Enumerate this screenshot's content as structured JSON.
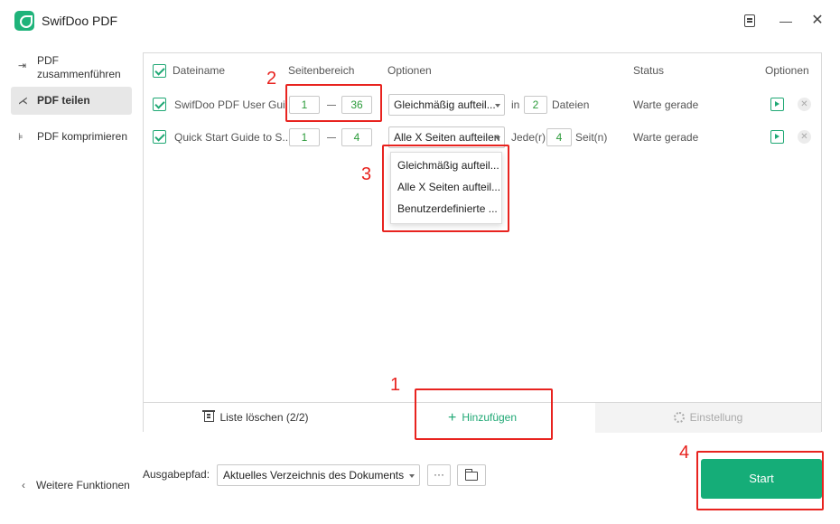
{
  "app": {
    "title": "SwifDoo PDF",
    "brand_color": "#1fb37a"
  },
  "window_controls": {
    "minimize": "—",
    "close": "✕"
  },
  "sidebar": {
    "items": [
      {
        "label": "PDF zusammenführen",
        "icon": "merge-icon"
      },
      {
        "label": "PDF teilen",
        "icon": "split-icon",
        "active": true
      },
      {
        "label": "PDF komprimieren",
        "icon": "compress-icon"
      }
    ],
    "more_label": "Weitere Funktionen"
  },
  "table": {
    "headers": {
      "name": "Dateiname",
      "range": "Seitenbereich",
      "options": "Optionen",
      "status": "Status",
      "actions": "Optionen"
    },
    "rows": [
      {
        "name": "SwifDoo PDF User Gui...",
        "from": "1",
        "to": "36",
        "mode": "Gleichmäßig aufteil...",
        "pre": "in",
        "count": "2",
        "post": "Dateien",
        "status": "Warte gerade"
      },
      {
        "name": "Quick Start Guide to S...",
        "from": "1",
        "to": "4",
        "mode": "Alle X Seiten aufteilen",
        "pre": "Jede(r)",
        "count": "4",
        "post": "Seit(n)",
        "status": "Warte gerade"
      }
    ],
    "dropdown_options": [
      "Gleichmäßig aufteil...",
      "Alle X Seiten aufteil...",
      "Benutzerdefinierte ..."
    ]
  },
  "panel_footer": {
    "clear_label": "Liste löschen (2/2)",
    "add_label": "Hinzufügen",
    "settings_label": "Einstellung"
  },
  "output": {
    "label": "Ausgabepfad:",
    "path": "Aktuelles Verzeichnis des Dokuments",
    "more_label": "···"
  },
  "start_label": "Start",
  "annotations": {
    "a1": "1",
    "a2": "2",
    "a3": "3",
    "a4": "4",
    "color": "#e8231f"
  }
}
